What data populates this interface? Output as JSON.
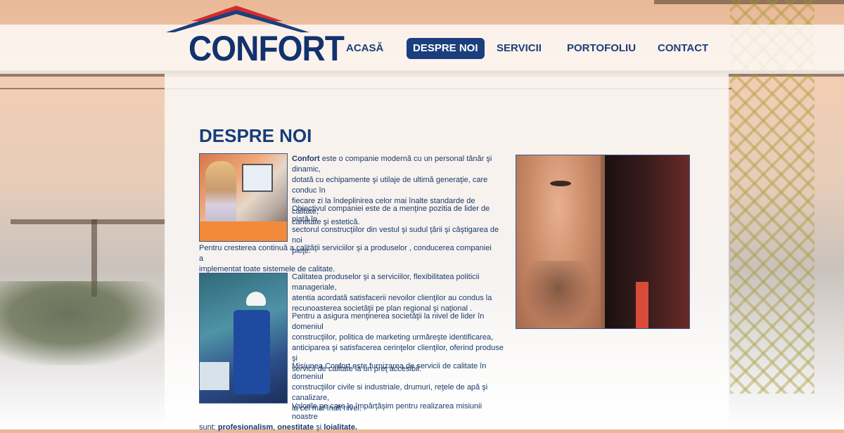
{
  "header": {
    "logo_text": "CONFORT",
    "nav": [
      {
        "label": "ACASĂ",
        "active": false
      },
      {
        "label": "DESPRE NOI",
        "active": true
      },
      {
        "label": "SERVICII",
        "active": false
      },
      {
        "label": "PORTOFOLIU",
        "active": false
      },
      {
        "label": "CONTACT",
        "active": false
      }
    ]
  },
  "main": {
    "title": "DESPRE NOI",
    "p1_bold": "Confort",
    "p1_rest_lines": [
      " este o companie modernă cu un personal tânăr şi dinamic,",
      "dotată cu echipamente şi utilaje de ultimă generaţie, care conduc în",
      "fiecare zi la îndeplinirea celor mai înalte standarde de calitate,",
      "cantitate şi estetică."
    ],
    "p2_lines": [
      "Obiectivul companiei este de a menţine pozitia de lider de piaţă în",
      "sectorul construcţiilor din vestul şi sudul ţării şi câştigarea de noi",
      "pieţe."
    ],
    "p3_lines": [
      "Pentru cresterea continuă a calităţii serviciilor şi a produselor , conducerea companiei a",
      "implementat toate sistemele de calitate."
    ],
    "p4_lines": [
      "Calitatea produselor şi a serviciilor, flexibilitatea politicii manageriale,",
      "atentia acordată satisfacerii nevoilor clienţilor au condus la",
      "recunoasterea societăţii pe plan regional şi naţional ."
    ],
    "p5_lines": [
      "Pentru a asigura menţinerea societăţii la nivel de lider în domeniul",
      "construcţiilor, politica de marketing urmăreşte identificarea,",
      "anticiparea şi satisfacerea cerinţelor clienţilor, oferind produse şi",
      "servicii de calitate la un preţ accesibil."
    ],
    "p6_lines": [
      "Misiunea Confort este furnizarea de servicii de calitate în domeniul",
      "construcţiilor civile si industriale, drumuri, reţele de apă şi canalizare,",
      "la cel mai înalt nivel."
    ],
    "p7_line1": "Valorile pe care le împărţăşim pentru realizarea misiunii noastre",
    "p7_prefix": "sunt: ",
    "p7_v1": "profesionalism",
    "p7_sep1": ", ",
    "p7_v2": "onestitate",
    "p7_sep2": " şi ",
    "p7_v3": "loialitate."
  },
  "colors": {
    "brand_blue": "#163d7a",
    "nav_active_bg": "#1b3f7d",
    "logo_roof_red": "#d52b2b"
  }
}
